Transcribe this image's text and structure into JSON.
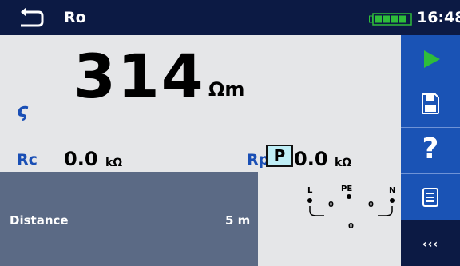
{
  "header": {
    "title": "Ro",
    "time": "16:48",
    "back_icon": "back-arrow-icon",
    "battery_icon": "battery-full-icon"
  },
  "result": {
    "symbol": "ς",
    "value": "314",
    "unit": "Ωm"
  },
  "sub_results": [
    {
      "label": "Rc",
      "value": "0.0",
      "unit": "kΩ"
    },
    {
      "label": "Rp",
      "value": "0.0",
      "unit": "kΩ"
    }
  ],
  "parameters": [
    {
      "name": "Distance",
      "value": "5 m"
    }
  ],
  "p_badge": "P",
  "terminals": {
    "labels": [
      "L",
      "PE",
      "N"
    ],
    "values": [
      "0",
      "0",
      "0"
    ]
  },
  "sidebar": {
    "buttons": [
      {
        "name": "start",
        "icon": "play-icon"
      },
      {
        "name": "save",
        "icon": "save-icon"
      },
      {
        "name": "help",
        "icon": "help-icon",
        "label": "?"
      },
      {
        "name": "options",
        "icon": "list-icon"
      },
      {
        "name": "more",
        "label": "‹‹‹"
      }
    ]
  },
  "colors": {
    "header_bg": "#0c1a44",
    "main_bg": "#e5e6e8",
    "accent_blue": "#1a4fb5",
    "sidebar_bg": "#1a53b5",
    "param_panel_bg": "#5b6a85",
    "play_green": "#2ebd3a",
    "battery_green": "#2ebd3a",
    "badge_bg": "#bfeef6"
  }
}
